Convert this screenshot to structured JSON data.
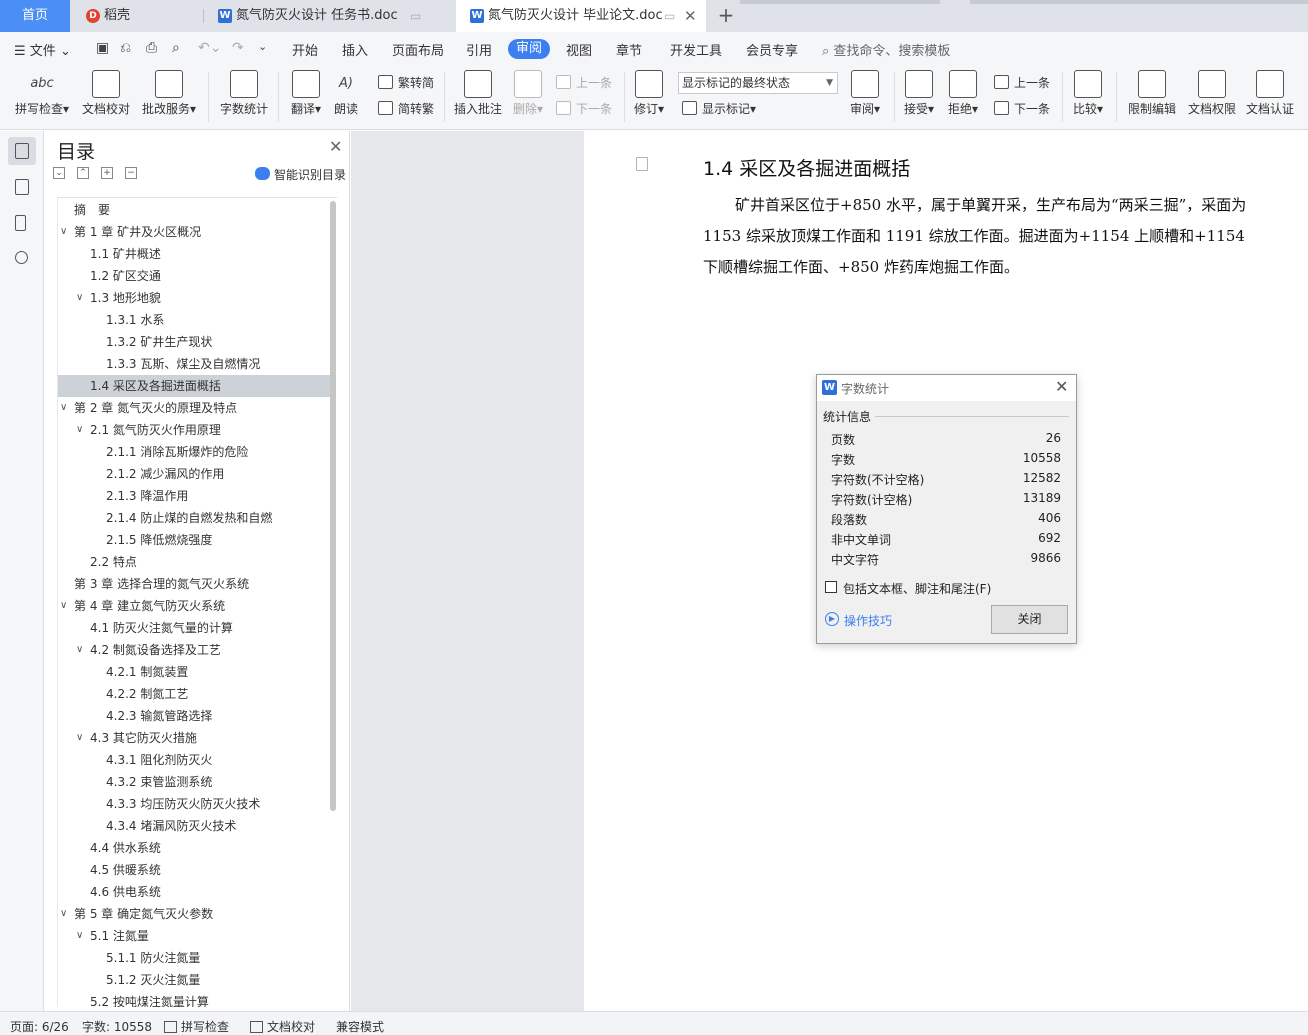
{
  "tabs": {
    "home": "首页",
    "items": [
      {
        "label": "稻壳",
        "icon": "docer-icon"
      },
      {
        "label": "氮气防灭火设计 任务书.doc",
        "icon": "word-doc-icon"
      },
      {
        "label": "氮气防灭火设计 毕业论文.doc",
        "icon": "word-doc-icon",
        "active": true
      }
    ],
    "new_tab": "+"
  },
  "menubar": {
    "file": "文件",
    "items": [
      "开始",
      "插入",
      "页面布局",
      "引用",
      "审阅",
      "视图",
      "章节",
      "开发工具",
      "会员专享"
    ],
    "active": "审阅",
    "search": "查找命令、搜索模板"
  },
  "ribbon": {
    "spell_check": "拼写检查",
    "doc_proof": "文档校对",
    "batch_service": "批改服务",
    "word_count": "字数统计",
    "translate": "翻译",
    "read_aloud": "朗读",
    "trad_to_simp": "繁转简",
    "simp_to_trad": "简转繁",
    "insert_comment": "插入批注",
    "delete": "删除",
    "prev_comment": "上一条",
    "next_comment": "下一条",
    "revise": "修订",
    "markup_state": "显示标记的最终状态",
    "show_markup": "显示标记",
    "review_pane": "审阅",
    "accept": "接受",
    "reject": "拒绝",
    "prev_change": "上一条",
    "next_change": "下一条",
    "compare": "比较",
    "restrict_edit": "限制编辑",
    "doc_permission": "文档权限",
    "doc_certify": "文档认证"
  },
  "toc": {
    "title": "目录",
    "smart": "智能识别目录",
    "items": [
      {
        "label": "摘　要",
        "level": 0,
        "arrow": false
      },
      {
        "label": "第 1 章  矿井及火区概况",
        "level": 0,
        "arrow": true
      },
      {
        "label": "1.1 矿井概述",
        "level": 1,
        "arrow": false
      },
      {
        "label": "1.2 矿区交通",
        "level": 1,
        "arrow": false
      },
      {
        "label": "1.3 地形地貌",
        "level": 1,
        "arrow": true
      },
      {
        "label": "1.3.1 水系",
        "level": 2,
        "arrow": false
      },
      {
        "label": "1.3.2 矿井生产现状",
        "level": 2,
        "arrow": false
      },
      {
        "label": "1.3.3 瓦斯、煤尘及自燃情况",
        "level": 2,
        "arrow": false
      },
      {
        "label": "1.4 采区及各掘进面概括",
        "level": 1,
        "arrow": false,
        "selected": true
      },
      {
        "label": "第 2 章  氮气灭火的原理及特点",
        "level": 0,
        "arrow": true
      },
      {
        "label": "2.1 氮气防灭火作用原理",
        "level": 1,
        "arrow": true
      },
      {
        "label": "2.1.1 消除瓦斯爆炸的危险",
        "level": 2,
        "arrow": false
      },
      {
        "label": "2.1.2 减少漏风的作用",
        "level": 2,
        "arrow": false
      },
      {
        "label": "2.1.3 降温作用",
        "level": 2,
        "arrow": false
      },
      {
        "label": "2.1.4 防止煤的自燃发热和自燃",
        "level": 2,
        "arrow": false
      },
      {
        "label": "2.1.5 降低燃烧强度",
        "level": 2,
        "arrow": false
      },
      {
        "label": "2.2 特点",
        "level": 1,
        "arrow": false
      },
      {
        "label": "第 3 章  选择合理的氮气灭火系统",
        "level": 0,
        "arrow": false
      },
      {
        "label": "第 4 章  建立氮气防灭火系统",
        "level": 0,
        "arrow": true
      },
      {
        "label": "4.1 防灭火注氮气量的计算",
        "level": 1,
        "arrow": false
      },
      {
        "label": "4.2 制氮设备选择及工艺",
        "level": 1,
        "arrow": true
      },
      {
        "label": "4.2.1 制氮装置",
        "level": 2,
        "arrow": false
      },
      {
        "label": "4.2.2 制氮工艺",
        "level": 2,
        "arrow": false
      },
      {
        "label": "4.2.3 输氮管路选择",
        "level": 2,
        "arrow": false
      },
      {
        "label": "4.3 其它防灭火措施",
        "level": 1,
        "arrow": true
      },
      {
        "label": "4.3.1 阻化剂防灭火",
        "level": 2,
        "arrow": false
      },
      {
        "label": "4.3.2 束管监测系统",
        "level": 2,
        "arrow": false
      },
      {
        "label": "4.3.3 均压防灭火防灭火技术",
        "level": 2,
        "arrow": false
      },
      {
        "label": "4.3.4 堵漏风防灭火技术",
        "level": 2,
        "arrow": false
      },
      {
        "label": "4.4 供水系统",
        "level": 1,
        "arrow": false
      },
      {
        "label": "4.5 供暖系统",
        "level": 1,
        "arrow": false
      },
      {
        "label": "4.6 供电系统",
        "level": 1,
        "arrow": false
      },
      {
        "label": "第 5 章  确定氮气灭火参数",
        "level": 0,
        "arrow": true
      },
      {
        "label": "5.1 注氮量",
        "level": 1,
        "arrow": true
      },
      {
        "label": "5.1.1 防火注氮量",
        "level": 2,
        "arrow": false
      },
      {
        "label": "5.1.2 灭火注氮量",
        "level": 2,
        "arrow": false
      },
      {
        "label": "5.2 按吨煤注氮量计算",
        "level": 1,
        "arrow": false
      }
    ]
  },
  "document": {
    "heading": "1.4 采区及各掘进面概括",
    "paragraph": "矿井首采区位于+850 水平，属于单翼开采，生产布局为“两采三掘”，采面为 1153 综采放顶煤工作面和 1191 综放工作面。掘进面为+1154 上顺槽和+1154 下顺槽综掘工作面、+850 炸药库炮掘工作面。"
  },
  "dialog": {
    "title": "字数统计",
    "group": "统计信息",
    "stats": [
      {
        "label": "页数",
        "value": "26"
      },
      {
        "label": "字数",
        "value": "10558"
      },
      {
        "label": "字符数(不计空格)",
        "value": "12582"
      },
      {
        "label": "字符数(计空格)",
        "value": "13189"
      },
      {
        "label": "段落数",
        "value": "406"
      },
      {
        "label": "非中文单词",
        "value": "692"
      },
      {
        "label": "中文字符",
        "value": "9866"
      }
    ],
    "checkbox": "包括文本框、脚注和尾注(F)",
    "tips": "操作技巧",
    "close": "关闭"
  },
  "status": {
    "page": "页面: 6/26",
    "words": "字数: 10558",
    "spell": "拼写检查",
    "proof": "文档校对",
    "compat": "兼容模式"
  },
  "colors": {
    "accent": "#3c7ff0",
    "home_tab": "#4b8ef5",
    "selection": "#cdd1d8"
  }
}
